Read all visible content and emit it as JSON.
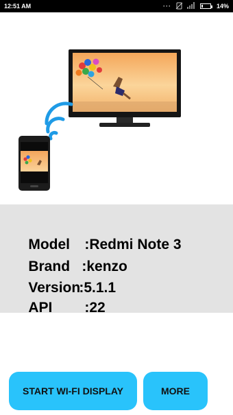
{
  "status_bar": {
    "time": "12:51 AM",
    "battery_percent_text": "14%",
    "battery_level": 0.14,
    "icons": [
      "more-dots-icon",
      "no-sim-icon",
      "signal-icon",
      "battery-icon"
    ]
  },
  "device_info": {
    "rows": [
      {
        "label": "Model",
        "value": ":Redmi Note 3"
      },
      {
        "label": "Brand",
        "value": ":kenzo"
      },
      {
        "label": "Version",
        "value": ":5.1.1"
      },
      {
        "label": "API",
        "value": ":22"
      }
    ]
  },
  "buttons": {
    "start_label": "START WI-FI DISPLAY",
    "more_label": "MORE"
  },
  "colors": {
    "button_bg": "#29c3fb",
    "panel_bg": "#e3e3e3",
    "wifi_waves": "#1f9be6"
  }
}
